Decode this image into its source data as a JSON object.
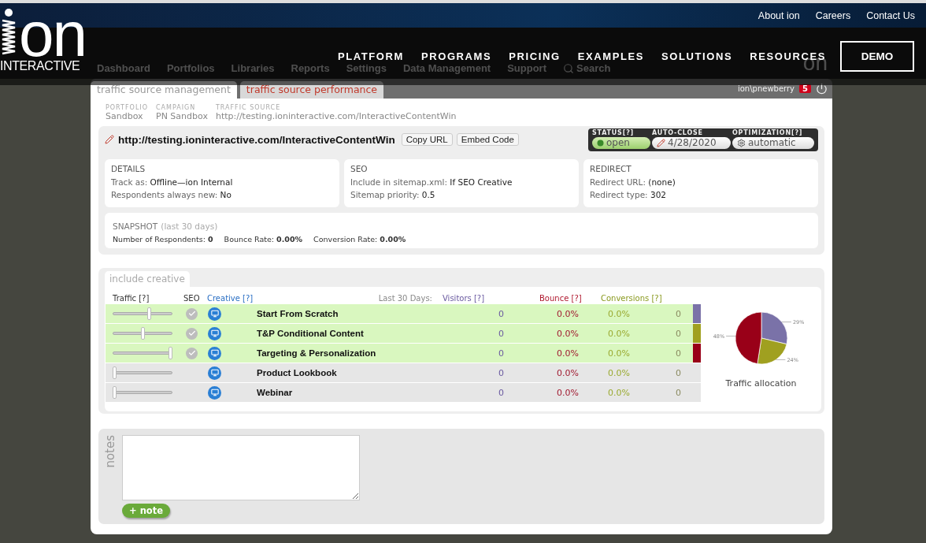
{
  "site_header": {
    "top_links": [
      "About ion",
      "Careers",
      "Contact Us"
    ],
    "logo": {
      "word": "on",
      "tagline": "INTERACTIVE"
    },
    "nav": [
      "PLATFORM",
      "PROGRAMS",
      "PRICING",
      "EXAMPLES",
      "SOLUTIONS",
      "RESOURCES"
    ],
    "cta": "DEMO"
  },
  "app_nav": {
    "items": [
      "Dashboard",
      "Portfolios",
      "Libraries",
      "Reports",
      "Settings",
      "Data Management",
      "Support"
    ],
    "search": "Search",
    "logo": "on"
  },
  "tabs": [
    {
      "label": "traffic source management",
      "selected": true
    },
    {
      "label": "traffic source performance",
      "selected": false
    }
  ],
  "user": {
    "name": "ion\\pnewberry",
    "badge": "5"
  },
  "breadcrumb": [
    {
      "label": "PORTFOLIO",
      "value": "Sandbox"
    },
    {
      "label": "CAMPAIGN",
      "value": "PN Sandbox"
    },
    {
      "label": "TRAFFIC SOURCE",
      "value": "http://testing.ioninteractive.com/InteractiveContentWin"
    }
  ],
  "source": {
    "url": "http://testing.ioninteractive.com/InteractiveContentWin",
    "buttons": [
      "Copy URL",
      "Embed Code"
    ]
  },
  "status": [
    {
      "kind": "status",
      "label": "STATUS[?]",
      "value": "open"
    },
    {
      "kind": "date",
      "label": "AUTO-CLOSE",
      "value": "4/28/2020"
    },
    {
      "kind": "setting",
      "label": "OPTIMIZATION[?]",
      "value": "automatic"
    }
  ],
  "cards": [
    {
      "title": "DETAILS",
      "lines": [
        {
          "label": "Track as:",
          "value": "Offline—ion Internal"
        },
        {
          "label": "Respondents always new:",
          "value": "No"
        }
      ]
    },
    {
      "title": "SEO",
      "lines": [
        {
          "label": "Include in sitemap.xml:",
          "value": "If SEO Creative"
        },
        {
          "label": "Sitemap priority:",
          "value": "0.5"
        }
      ]
    },
    {
      "title": "REDIRECT",
      "lines": [
        {
          "label": "Redirect URL:",
          "value": "(none)"
        },
        {
          "label": "Redirect type:",
          "value": "302"
        }
      ]
    }
  ],
  "snapshot": {
    "title": "SNAPSHOT",
    "period": "(last 30 days)",
    "metrics": [
      "Number of Respondents: **0**",
      "Bounce Rate: **0.00%**",
      "Conversion Rate: **0.00%**"
    ]
  },
  "creative": {
    "tab": "include creative",
    "headers": {
      "traffic": "Traffic [?]",
      "seo": "SEO",
      "creative": "Creative [?]",
      "period": "Last 30 Days:",
      "visitors": "Visitors [?]",
      "bounce": "Bounce [?]",
      "conversions": "Conversions [?]"
    },
    "rows": [
      {
        "name": "Start From Scratch",
        "included": true,
        "seo_checked": true,
        "level": 0.62,
        "visitors": "0",
        "bounce": "0.0%",
        "conversion_rate": "0.0%",
        "conversions": "0",
        "color": "#7a72a8"
      },
      {
        "name": "T&P Conditional Content",
        "included": true,
        "seo_checked": true,
        "level": 0.5,
        "visitors": "0",
        "bounce": "0.0%",
        "conversion_rate": "0.0%",
        "conversions": "0",
        "color": "#a0a020"
      },
      {
        "name": "Targeting & Personalization",
        "included": true,
        "seo_checked": true,
        "level": 1,
        "visitors": "0",
        "bounce": "0.0%",
        "conversion_rate": "0.0%",
        "conversions": "0",
        "color": "#990018"
      },
      {
        "name": "Product Lookbook",
        "included": false,
        "seo_checked": false,
        "level": 0,
        "visitors": "0",
        "bounce": "0.0%",
        "conversion_rate": "0.0%",
        "conversions": "0"
      },
      {
        "name": "Webinar",
        "included": false,
        "seo_checked": false,
        "level": 0,
        "visitors": "0",
        "bounce": "0.0%",
        "conversion_rate": "0.0%",
        "conversions": "0"
      }
    ],
    "chart_data": {
      "type": "pie",
      "title": "Traffic allocation",
      "values": [
        29,
        24,
        48
      ],
      "value_labels": [
        "29%",
        "24%",
        "48%"
      ]
    }
  },
  "notes": {
    "label": "notes",
    "button": "+ note"
  }
}
